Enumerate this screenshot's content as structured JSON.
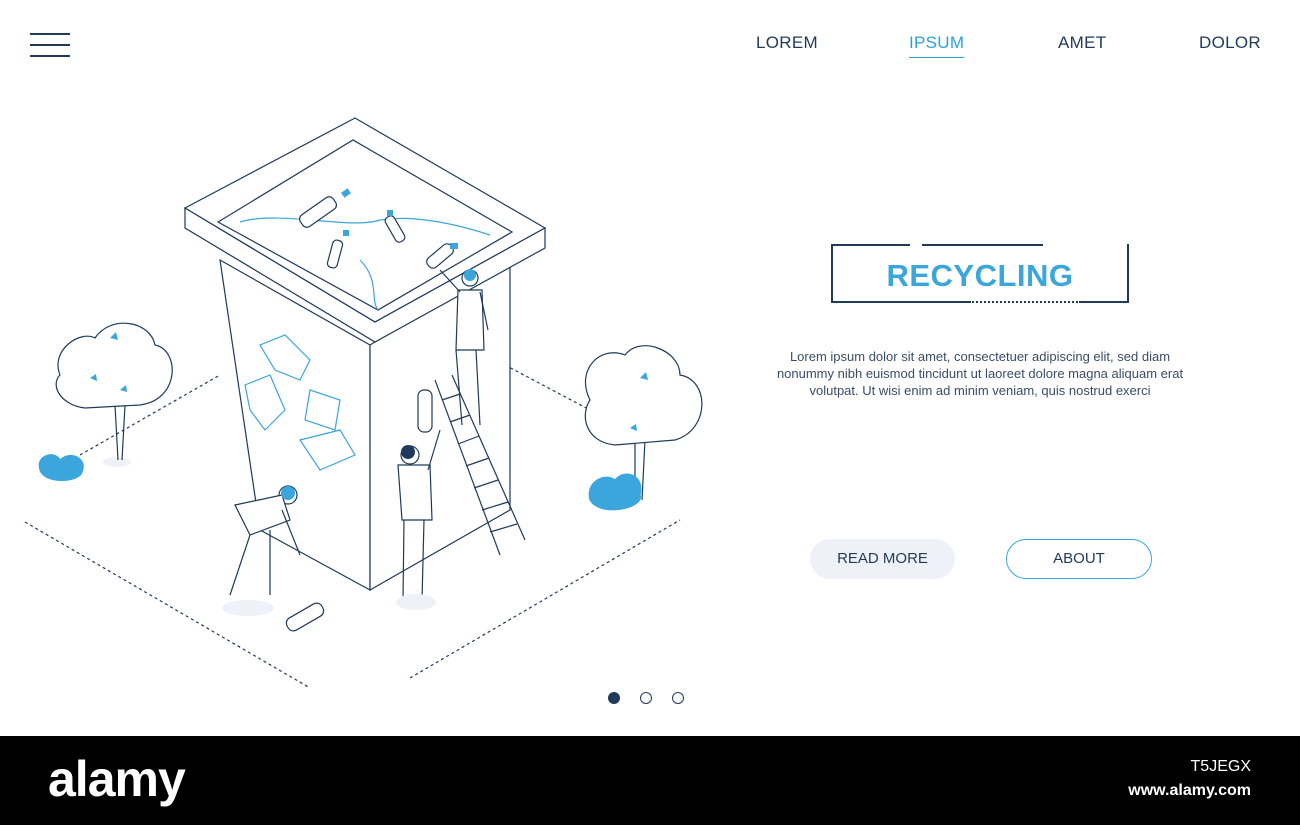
{
  "header": {
    "menu_icon": "hamburger-menu-icon",
    "nav": [
      {
        "label": "LOREM",
        "active": false
      },
      {
        "label": "IPSUM",
        "active": true
      },
      {
        "label": "AMET",
        "active": false
      },
      {
        "label": "DOLOR",
        "active": false
      }
    ]
  },
  "hero": {
    "title": "RECYCLING",
    "description": "Lorem ipsum dolor sit amet, consectetuer adipiscing elit, sed diam nonummy nibh euismod tincidunt ut laoreet dolore magna aliquam erat volutpat. Ut wisi enim ad minim veniam, quis nostrud exerci",
    "buttons": {
      "read_more": "READ MORE",
      "about": "ABOUT"
    },
    "illustration_icon": "recycling-bin-illustration"
  },
  "pagination": {
    "total": 3,
    "active_index": 0
  },
  "watermark": {
    "logo": "alamy",
    "image_id": "T5JEGX",
    "url": "www.alamy.com"
  },
  "colors": {
    "accent": "#3aa6dc",
    "navy": "#1f3a5a",
    "light_button": "#eef1f7",
    "footer": "#000000"
  }
}
